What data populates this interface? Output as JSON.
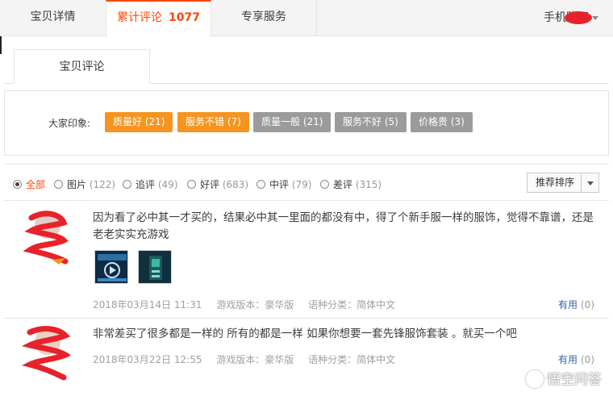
{
  "tabs": [
    {
      "label": "宝贝详情"
    },
    {
      "label": "累计评论",
      "count": "1077"
    },
    {
      "label": "专享服务"
    }
  ],
  "mobile_buy": "手机购买",
  "subtab": "宝贝评论",
  "impressions": {
    "label": "大家印象:",
    "tags": [
      {
        "text": "质量好 (21)",
        "tone": "positive"
      },
      {
        "text": "服务不错 (7)",
        "tone": "positive"
      },
      {
        "text": "质量一般 (21)",
        "tone": "negative"
      },
      {
        "text": "服务不好 (5)",
        "tone": "negative"
      },
      {
        "text": "价格贵 (3)",
        "tone": "negative"
      }
    ]
  },
  "filters": [
    {
      "label": "全部",
      "count": "",
      "selected": true
    },
    {
      "label": "图片",
      "count": "(122)",
      "selected": false
    },
    {
      "label": "追评",
      "count": "(49)",
      "selected": false
    },
    {
      "label": "好评",
      "count": "(683)",
      "selected": false
    },
    {
      "label": "中评",
      "count": "(79)",
      "selected": false
    },
    {
      "label": "差评",
      "count": "(315)",
      "selected": false
    }
  ],
  "sort_button": "推荐排序",
  "reviews": [
    {
      "text": "因为看了必中其一才买的，结果必中其一里面的都没有中，得了个新手服一样的服饰，觉得不靠谱，还是老老实实充游戏",
      "date": "2018年03月14日 11:31",
      "version": "游戏版本：豪华版",
      "language": "语种分类：简体中文",
      "useful_label": "有用",
      "useful_count": "(0)"
    },
    {
      "text": "非常差买了很多都是一样的 所有的都是一样 如果你想要一套先锋服饰套装 。就买一个吧",
      "date": "2018年03月22日 12:55",
      "version": "游戏版本：豪华版",
      "language": "语种分类：简体中文",
      "useful_label": "有用",
      "useful_count": "(0)"
    }
  ],
  "watermark": "悟空问答",
  "colors": {
    "accent": "#ff4400",
    "tag_positive": "#f59520",
    "tag_negative": "#9b9b9b",
    "redaction": "#e8222a"
  }
}
